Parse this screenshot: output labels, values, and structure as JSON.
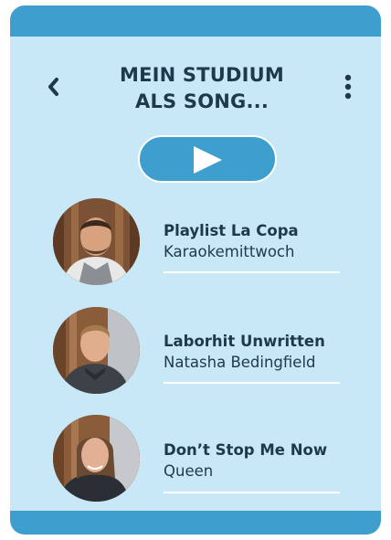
{
  "header": {
    "title_line1": "MEIN STUDIUM",
    "title_line2": "ALS SONG...",
    "back_icon": "chevron-left-icon",
    "more_icon": "more-vertical-icon"
  },
  "player": {
    "play_icon": "play-icon"
  },
  "songs": [
    {
      "title": "Playlist La Copa",
      "artist": "Karaokemittwoch"
    },
    {
      "title": "Laborhit Unwritten",
      "artist": "Natasha Bedingfield"
    },
    {
      "title": "Don’t Stop Me Now",
      "artist": "Queen"
    }
  ],
  "colors": {
    "background": "#c8e7f7",
    "accent": "#3e9fcf",
    "text": "#1d3a4a",
    "divider": "#ffffff"
  }
}
